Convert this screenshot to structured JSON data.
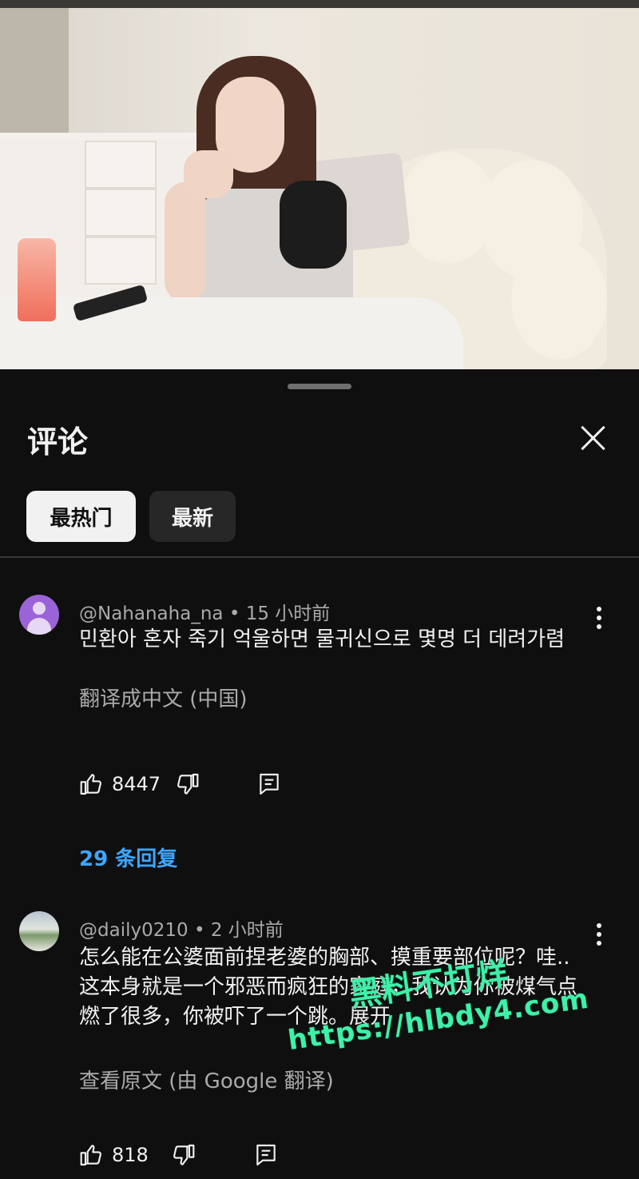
{
  "sheet": {
    "title": "评论",
    "sort_tabs": [
      {
        "label": "最热门",
        "selected": true
      },
      {
        "label": "最新",
        "selected": false
      }
    ]
  },
  "comments": [
    {
      "author": "@Nahanaha_na",
      "time": "15 小时前",
      "text": "민환아 혼자 죽기 억울하면 물귀신으로 몇명 더 데려가렴",
      "translate_label": "翻译成中文 (中国)",
      "likes": "8447",
      "replies_label": "29 条回复"
    },
    {
      "author": "@daily0210",
      "time": "2 小时前",
      "text": "怎么能在公婆面前捏老婆的胸部、摸重要部位呢？哇.. 这本身就是一个邪恶而疯狂的家庭，我认为你被煤气点燃了很多，你被吓了一个跳。展开",
      "translate_label": "查看原文 (由 Google 翻译)",
      "likes": "818"
    }
  ],
  "watermark": {
    "line1": "黑料不打烊",
    "line2": "https://hlbdy4.com"
  },
  "colors": {
    "background": "#0f0f0f",
    "link_blue": "#3ea6ff",
    "watermark_green": "#3ff0a8"
  }
}
